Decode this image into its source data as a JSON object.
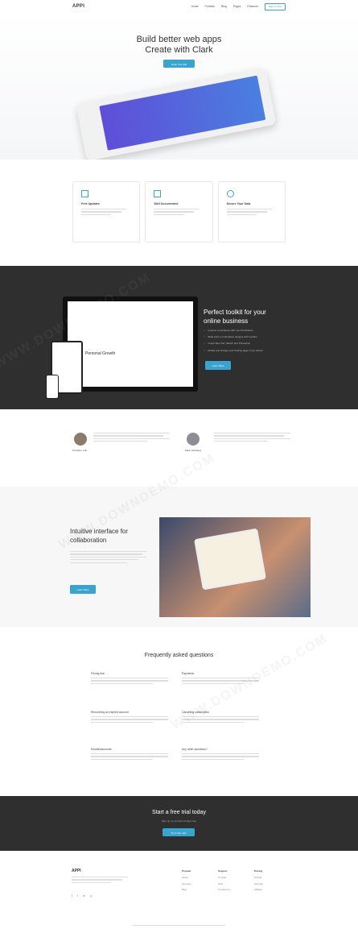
{
  "nav": {
    "brand": "APPI",
    "links": [
      "Home",
      "Portfolio",
      "Blog",
      "Pages",
      "Features"
    ],
    "signup": "Sign up free"
  },
  "hero": {
    "title_line1": "Build better web apps",
    "title_line2": "Create with Clark",
    "button": "Enter free trial"
  },
  "features": [
    {
      "title": "Free Updates",
      "icon": "grid-icon"
    },
    {
      "title": "Well Documented",
      "icon": "folder-icon"
    },
    {
      "title": "Secure Your Data",
      "icon": "lightbulb-icon"
    }
  ],
  "toolkit": {
    "title_line1": "Perfect toolkit for your",
    "title_line2": "online business",
    "mockup_title": "Personal Growth",
    "items": [
      "Improve consistency with over 50 libraries",
      "Build tools on interactive designs with Invefine",
      "Import files from Sketch and Photoshop",
      "Modify and change your landing page in any device"
    ],
    "button": "Learn More"
  },
  "testimonials": [
    {
      "name": "Christine Cuh"
    },
    {
      "name": "Mark Johnberg"
    }
  ],
  "collab": {
    "title_line1": "Intuitive interface for",
    "title_line2": "collaboration",
    "button": "Learn More"
  },
  "faq": {
    "title": "Frequently asked questions",
    "items": [
      {
        "q": "Pricing trial"
      },
      {
        "q": "Payments"
      },
      {
        "q": "Recovering an expired account"
      },
      {
        "q": "Canceling subscription"
      },
      {
        "q": "Emails/discounts"
      },
      {
        "q": "Any other questions?"
      }
    ]
  },
  "cta": {
    "title": "Start a free trial today",
    "subtitle": "Sign up no contract 14 days free",
    "button": "Try it free now"
  },
  "footer": {
    "brand": "APPI",
    "cols": [
      {
        "h": "Product",
        "links": [
          "About",
          "Services",
          "Blog"
        ]
      },
      {
        "h": "Support",
        "links": [
          "Contact",
          "FAQ",
          "Contact Us"
        ]
      },
      {
        "h": "Pricing",
        "links": [
          "Pricing",
          "Security",
          "Affiliate"
        ]
      }
    ]
  },
  "watermark": "WWW.DOWNDEMO.COM"
}
